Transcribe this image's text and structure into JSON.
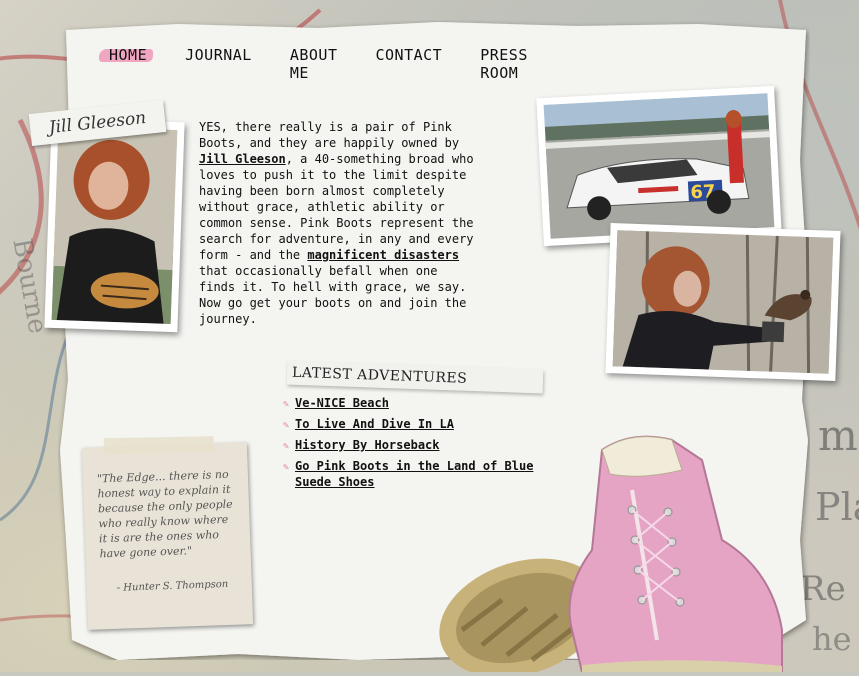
{
  "nav": {
    "items": [
      "HOME",
      "JOURNAL",
      "ABOUT ME",
      "CONTACT",
      "PRESS ROOM"
    ],
    "active": "HOME"
  },
  "profile": {
    "name_tag": "Jill Gleeson"
  },
  "intro": {
    "p1": "YES, there really is a pair of Pink Boots, and they are happily owned by ",
    "link1": "Jill Gleeson",
    "p2": ", a 40-something broad who loves to push it to the limit despite having been born almost completely without grace, athletic ability or common sense. Pink Boots represent the search for adventure, in any and every form - and the ",
    "link2": "magnificent disasters",
    "p3": " that occasionally befall when one finds it. To hell with grace, we say. Now go get your boots on and join the journey."
  },
  "latest": {
    "title": "LATEST ADVENTURES",
    "items": [
      "Ve-NICE Beach",
      "To Live And Dive In LA",
      "History By Horseback",
      "Go Pink Boots in the Land of Blue Suede Shoes"
    ]
  },
  "quote": {
    "text": "\"The Edge... there is no honest way to explain it because the only people who really know where it is are the ones who have gone over.\"",
    "author": "- Hunter S. Thompson"
  },
  "photos": {
    "car_number": "67"
  },
  "colors": {
    "accent_pink": "#f0a5c0",
    "bullet_pink": "#e48aa8",
    "paper": "#f4f4f1"
  }
}
